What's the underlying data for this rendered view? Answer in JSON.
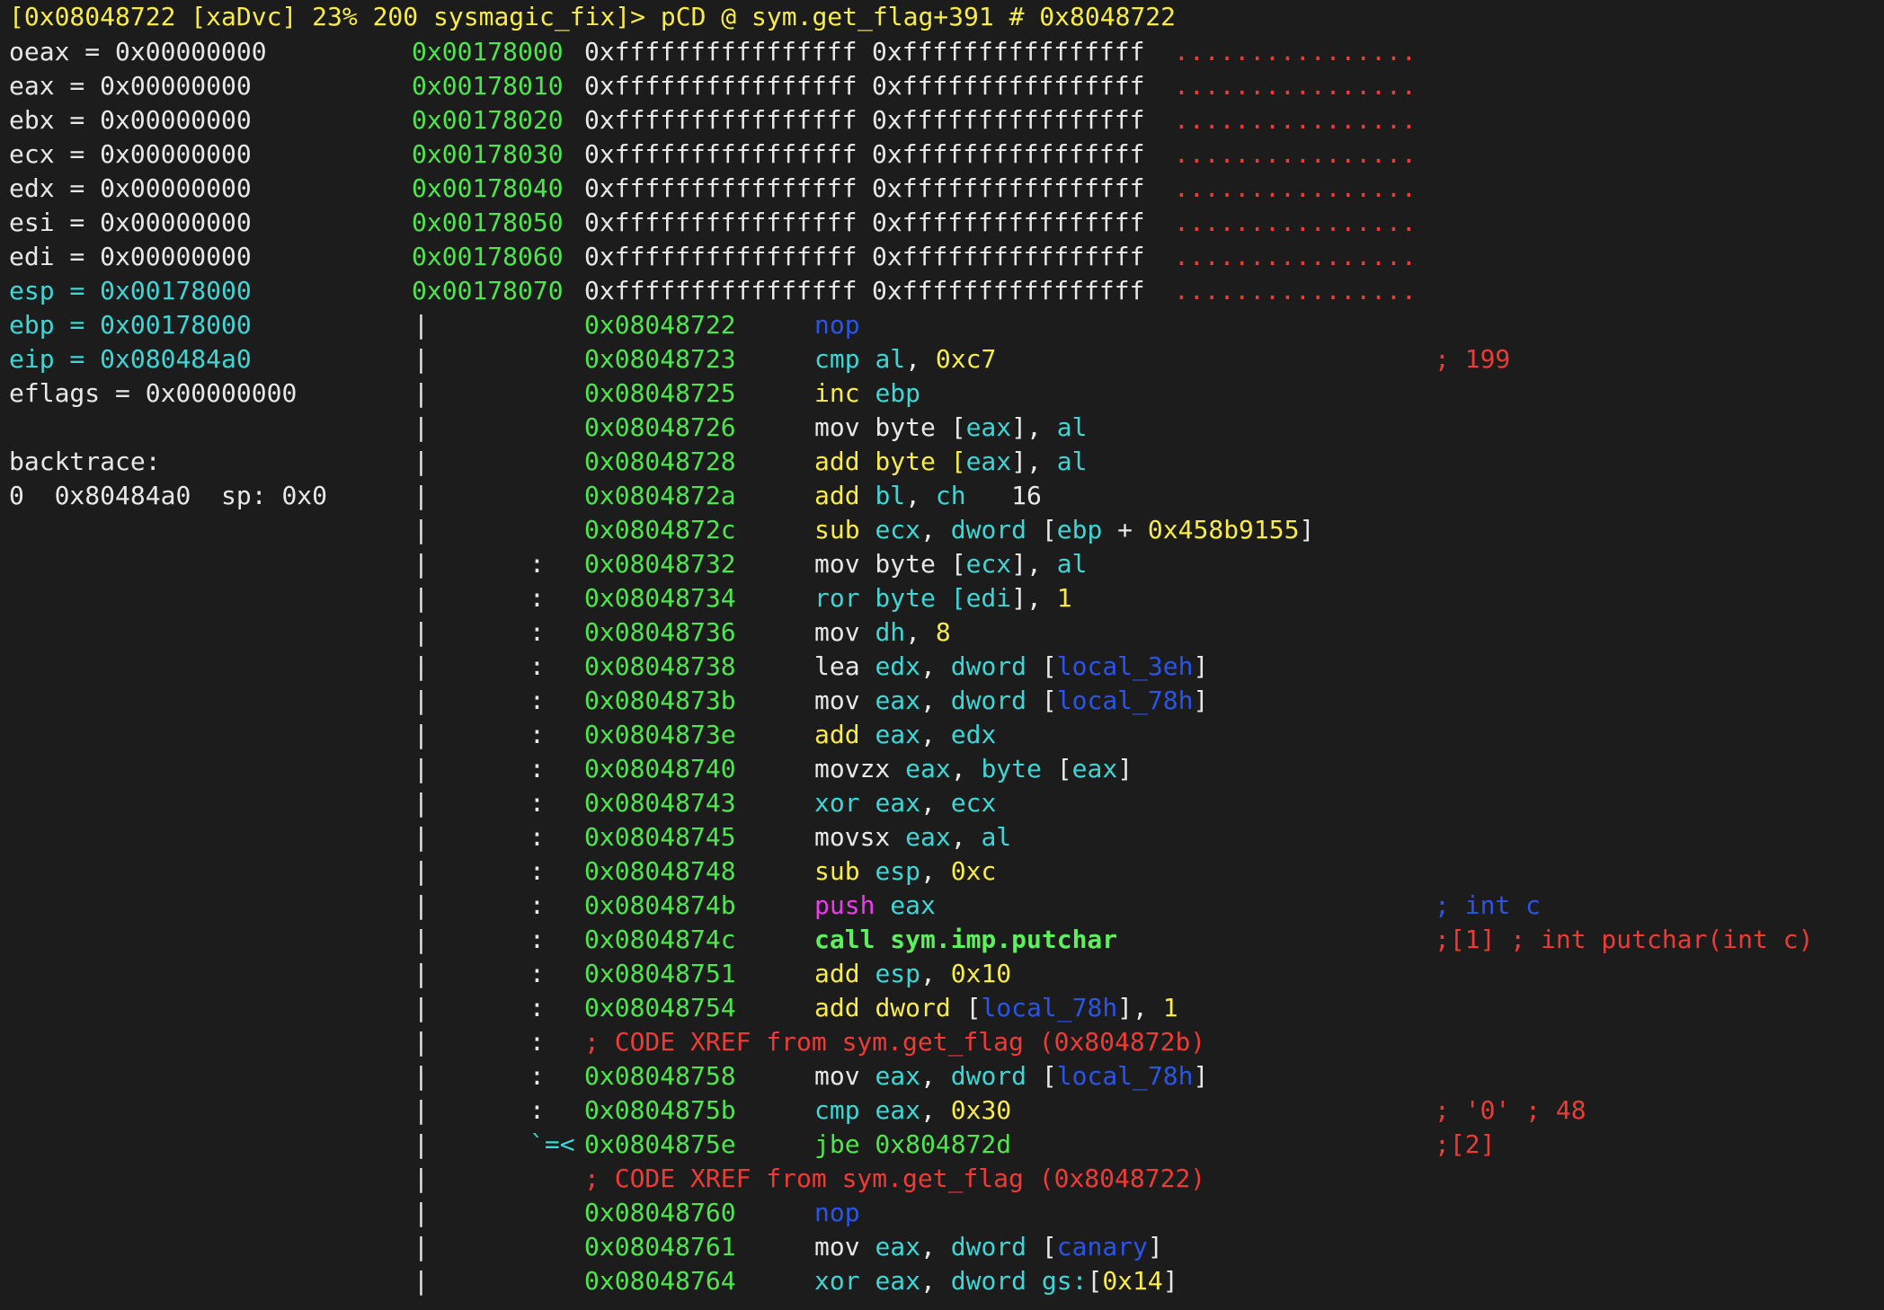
{
  "prompt": "[0x08048722 [xaDvc] 23% 200 sysmagic_fix]> pCD @ sym.get_flag+391 # 0x8048722",
  "registers": [
    {
      "name": "oeax",
      "value": "0x00000000",
      "color": "#e8e8e8"
    },
    {
      "name": "eax",
      "value": "0x00000000",
      "color": "#e8e8e8"
    },
    {
      "name": "ebx",
      "value": "0x00000000",
      "color": "#e8e8e8"
    },
    {
      "name": "ecx",
      "value": "0x00000000",
      "color": "#e8e8e8"
    },
    {
      "name": "edx",
      "value": "0x00000000",
      "color": "#e8e8e8"
    },
    {
      "name": "esi",
      "value": "0x00000000",
      "color": "#e8e8e8"
    },
    {
      "name": "edi",
      "value": "0x00000000",
      "color": "#e8e8e8"
    },
    {
      "name": "esp",
      "value": "0x00178000",
      "color": "#3fd6d6"
    },
    {
      "name": "ebp",
      "value": "0x00178000",
      "color": "#3fd6d6"
    },
    {
      "name": "eip",
      "value": "0x080484a0",
      "color": "#3fd6d6"
    },
    {
      "name": "eflags",
      "value": "0x00000000",
      "color": "#e8e8e8"
    }
  ],
  "backtrace": {
    "title": "backtrace:",
    "frames": [
      {
        "index": "0",
        "addr": "0x80484a0",
        "sp": "sp: 0x0"
      }
    ]
  },
  "hexdump": [
    {
      "addr": "0x00178000",
      "q1": "0xffffffffffffffff",
      "q2": "0xffffffffffffffff",
      "ascii": "................"
    },
    {
      "addr": "0x00178010",
      "q1": "0xffffffffffffffff",
      "q2": "0xffffffffffffffff",
      "ascii": "................"
    },
    {
      "addr": "0x00178020",
      "q1": "0xffffffffffffffff",
      "q2": "0xffffffffffffffff",
      "ascii": "................"
    },
    {
      "addr": "0x00178030",
      "q1": "0xffffffffffffffff",
      "q2": "0xffffffffffffffff",
      "ascii": "................"
    },
    {
      "addr": "0x00178040",
      "q1": "0xffffffffffffffff",
      "q2": "0xffffffffffffffff",
      "ascii": "................"
    },
    {
      "addr": "0x00178050",
      "q1": "0xffffffffffffffff",
      "q2": "0xffffffffffffffff",
      "ascii": "................"
    },
    {
      "addr": "0x00178060",
      "q1": "0xffffffffffffffff",
      "q2": "0xffffffffffffffff",
      "ascii": "................"
    },
    {
      "addr": "0x00178070",
      "q1": "0xffffffffffffffff",
      "q2": "0xffffffffffffffff",
      "ascii": "................"
    }
  ],
  "disasm": [
    {
      "flow": "|",
      "gutter": "",
      "addr": "0x08048722",
      "parts": [
        [
          "nop",
          "blue"
        ]
      ],
      "comment": "",
      "ccolor": ""
    },
    {
      "flow": "|",
      "gutter": "",
      "addr": "0x08048723",
      "parts": [
        [
          "cmp ",
          "cyan"
        ],
        [
          "al",
          "cyan"
        ],
        [
          ", ",
          "white"
        ],
        [
          "0xc7",
          "yellow"
        ]
      ],
      "comment": "; 199",
      "ccolor": "red"
    },
    {
      "flow": "|",
      "gutter": "",
      "addr": "0x08048725",
      "parts": [
        [
          "inc ",
          "yellow"
        ],
        [
          "ebp",
          "cyan"
        ]
      ],
      "comment": "",
      "ccolor": ""
    },
    {
      "flow": "|",
      "gutter": "",
      "addr": "0x08048726",
      "parts": [
        [
          "mov byte [",
          "white"
        ],
        [
          "eax",
          "cyan"
        ],
        [
          "], ",
          "white"
        ],
        [
          "al",
          "cyan"
        ]
      ],
      "comment": "",
      "ccolor": ""
    },
    {
      "flow": "|",
      "gutter": "",
      "addr": "0x08048728",
      "parts": [
        [
          "add byte [",
          "yellow"
        ],
        [
          "eax",
          "cyan"
        ],
        [
          "], ",
          "white"
        ],
        [
          "al",
          "cyan"
        ]
      ],
      "comment": "",
      "ccolor": ""
    },
    {
      "flow": "|",
      "gutter": "",
      "addr": "0x0804872a",
      "parts": [
        [
          "add ",
          "yellow"
        ],
        [
          "bl",
          "cyan"
        ],
        [
          ", ",
          "white"
        ],
        [
          "ch",
          "cyan"
        ],
        [
          "   16",
          "white"
        ]
      ],
      "comment": "",
      "ccolor": ""
    },
    {
      "flow": "|",
      "gutter": "",
      "addr": "0x0804872c",
      "parts": [
        [
          "sub ",
          "yellow"
        ],
        [
          "ecx",
          "cyan"
        ],
        [
          ", ",
          "white"
        ],
        [
          "dword",
          "cyan"
        ],
        [
          " [",
          "white"
        ],
        [
          "ebp",
          "cyan"
        ],
        [
          " + ",
          "white"
        ],
        [
          "0x458b9155",
          "yellow"
        ],
        [
          "]",
          "white"
        ]
      ],
      "comment": "",
      "ccolor": ""
    },
    {
      "flow": "|",
      "gutter": ":",
      "addr": "0x08048732",
      "parts": [
        [
          "mov byte [",
          "white"
        ],
        [
          "ecx",
          "cyan"
        ],
        [
          "], ",
          "white"
        ],
        [
          "al",
          "cyan"
        ]
      ],
      "comment": "",
      "ccolor": ""
    },
    {
      "flow": "|",
      "gutter": ":",
      "addr": "0x08048734",
      "parts": [
        [
          "ror byte [",
          "cyan"
        ],
        [
          "edi",
          "cyan"
        ],
        [
          "], ",
          "white"
        ],
        [
          "1",
          "yellow"
        ]
      ],
      "comment": "",
      "ccolor": ""
    },
    {
      "flow": "|",
      "gutter": ":",
      "addr": "0x08048736",
      "parts": [
        [
          "mov ",
          "white"
        ],
        [
          "dh",
          "cyan"
        ],
        [
          ", ",
          "white"
        ],
        [
          "8",
          "yellow"
        ]
      ],
      "comment": "",
      "ccolor": ""
    },
    {
      "flow": "|",
      "gutter": ":",
      "addr": "0x08048738",
      "parts": [
        [
          "lea ",
          "white"
        ],
        [
          "edx",
          "cyan"
        ],
        [
          ", ",
          "white"
        ],
        [
          "dword",
          "cyan"
        ],
        [
          " [",
          "white"
        ],
        [
          "local_3eh",
          "blue"
        ],
        [
          "]",
          "white"
        ]
      ],
      "comment": "",
      "ccolor": ""
    },
    {
      "flow": "|",
      "gutter": ":",
      "addr": "0x0804873b",
      "parts": [
        [
          "mov ",
          "white"
        ],
        [
          "eax",
          "cyan"
        ],
        [
          ", ",
          "white"
        ],
        [
          "dword",
          "cyan"
        ],
        [
          " [",
          "white"
        ],
        [
          "local_78h",
          "blue"
        ],
        [
          "]",
          "white"
        ]
      ],
      "comment": "",
      "ccolor": ""
    },
    {
      "flow": "|",
      "gutter": ":",
      "addr": "0x0804873e",
      "parts": [
        [
          "add ",
          "yellow"
        ],
        [
          "eax",
          "cyan"
        ],
        [
          ", ",
          "white"
        ],
        [
          "edx",
          "cyan"
        ]
      ],
      "comment": "",
      "ccolor": ""
    },
    {
      "flow": "|",
      "gutter": ":",
      "addr": "0x08048740",
      "parts": [
        [
          "movzx ",
          "white"
        ],
        [
          "eax",
          "cyan"
        ],
        [
          ", ",
          "white"
        ],
        [
          "byte",
          "cyan"
        ],
        [
          " [",
          "white"
        ],
        [
          "eax",
          "cyan"
        ],
        [
          "]",
          "white"
        ]
      ],
      "comment": "",
      "ccolor": ""
    },
    {
      "flow": "|",
      "gutter": ":",
      "addr": "0x08048743",
      "parts": [
        [
          "xor ",
          "cyan"
        ],
        [
          "eax",
          "cyan"
        ],
        [
          ", ",
          "white"
        ],
        [
          "ecx",
          "cyan"
        ]
      ],
      "comment": "",
      "ccolor": ""
    },
    {
      "flow": "|",
      "gutter": ":",
      "addr": "0x08048745",
      "parts": [
        [
          "movsx ",
          "white"
        ],
        [
          "eax",
          "cyan"
        ],
        [
          ", ",
          "white"
        ],
        [
          "al",
          "cyan"
        ]
      ],
      "comment": "",
      "ccolor": ""
    },
    {
      "flow": "|",
      "gutter": ":",
      "addr": "0x08048748",
      "parts": [
        [
          "sub ",
          "yellow"
        ],
        [
          "esp",
          "cyan"
        ],
        [
          ", ",
          "white"
        ],
        [
          "0xc",
          "yellow"
        ]
      ],
      "comment": "",
      "ccolor": ""
    },
    {
      "flow": "|",
      "gutter": ":",
      "addr": "0x0804874b",
      "parts": [
        [
          "push ",
          "magenta"
        ],
        [
          "eax",
          "cyan"
        ]
      ],
      "comment": "; int c",
      "ccolor": "blue"
    },
    {
      "flow": "|",
      "gutter": ":",
      "addr": "0x0804874c",
      "parts": [
        [
          "call sym.imp.putchar",
          "bgreen"
        ]
      ],
      "comment": ";[1] ; int putchar(int c)",
      "ccolor": "red"
    },
    {
      "flow": "|",
      "gutter": ":",
      "addr": "0x08048751",
      "parts": [
        [
          "add ",
          "yellow"
        ],
        [
          "esp",
          "cyan"
        ],
        [
          ", ",
          "white"
        ],
        [
          "0x10",
          "yellow"
        ]
      ],
      "comment": "",
      "ccolor": ""
    },
    {
      "flow": "|",
      "gutter": ":",
      "addr": "0x08048754",
      "parts": [
        [
          "add ",
          "yellow"
        ],
        [
          "dword",
          "yellow"
        ],
        [
          " [",
          "white"
        ],
        [
          "local_78h",
          "blue"
        ],
        [
          "], ",
          "white"
        ],
        [
          "1",
          "yellow"
        ]
      ],
      "comment": "",
      "ccolor": ""
    },
    {
      "flow": "|",
      "gutter": ":",
      "addr": "",
      "parts": [
        [
          "; CODE XREF from sym.get_flag (0x804872b)",
          "red"
        ]
      ],
      "comment": "",
      "ccolor": ""
    },
    {
      "flow": "|",
      "gutter": ":",
      "addr": "0x08048758",
      "parts": [
        [
          "mov ",
          "white"
        ],
        [
          "eax",
          "cyan"
        ],
        [
          ", ",
          "white"
        ],
        [
          "dword",
          "cyan"
        ],
        [
          " [",
          "white"
        ],
        [
          "local_78h",
          "blue"
        ],
        [
          "]",
          "white"
        ]
      ],
      "comment": "",
      "ccolor": ""
    },
    {
      "flow": "|",
      "gutter": ":",
      "addr": "0x0804875b",
      "parts": [
        [
          "cmp ",
          "cyan"
        ],
        [
          "eax",
          "cyan"
        ],
        [
          ", ",
          "white"
        ],
        [
          "0x30",
          "yellow"
        ]
      ],
      "comment": "; '0' ; 48",
      "ccolor": "red"
    },
    {
      "flow": "|",
      "gutter": "`=<",
      "addr": "0x0804875e",
      "parts": [
        [
          "jbe 0x804872d",
          "green"
        ]
      ],
      "comment": ";[2]",
      "ccolor": "red"
    },
    {
      "flow": "|",
      "gutter": "",
      "addr": "",
      "parts": [
        [
          "; CODE XREF from sym.get_flag (0x8048722)",
          "red"
        ]
      ],
      "comment": "",
      "ccolor": ""
    },
    {
      "flow": "|",
      "gutter": "",
      "addr": "0x08048760",
      "parts": [
        [
          "nop",
          "blue"
        ]
      ],
      "comment": "",
      "ccolor": ""
    },
    {
      "flow": "|",
      "gutter": "",
      "addr": "0x08048761",
      "parts": [
        [
          "mov ",
          "white"
        ],
        [
          "eax",
          "cyan"
        ],
        [
          ", ",
          "white"
        ],
        [
          "dword",
          "cyan"
        ],
        [
          " [",
          "white"
        ],
        [
          "canary",
          "blue"
        ],
        [
          "]",
          "white"
        ]
      ],
      "comment": "",
      "ccolor": ""
    },
    {
      "flow": "|",
      "gutter": "",
      "addr": "0x08048764",
      "parts": [
        [
          "xor ",
          "cyan"
        ],
        [
          "eax",
          "cyan"
        ],
        [
          ", ",
          "white"
        ],
        [
          "dword",
          "cyan"
        ],
        [
          " gs:",
          "cyan"
        ],
        [
          "[",
          "white"
        ],
        [
          "0x14",
          "yellow"
        ],
        [
          "]",
          "white"
        ]
      ],
      "comment": "",
      "ccolor": ""
    }
  ]
}
